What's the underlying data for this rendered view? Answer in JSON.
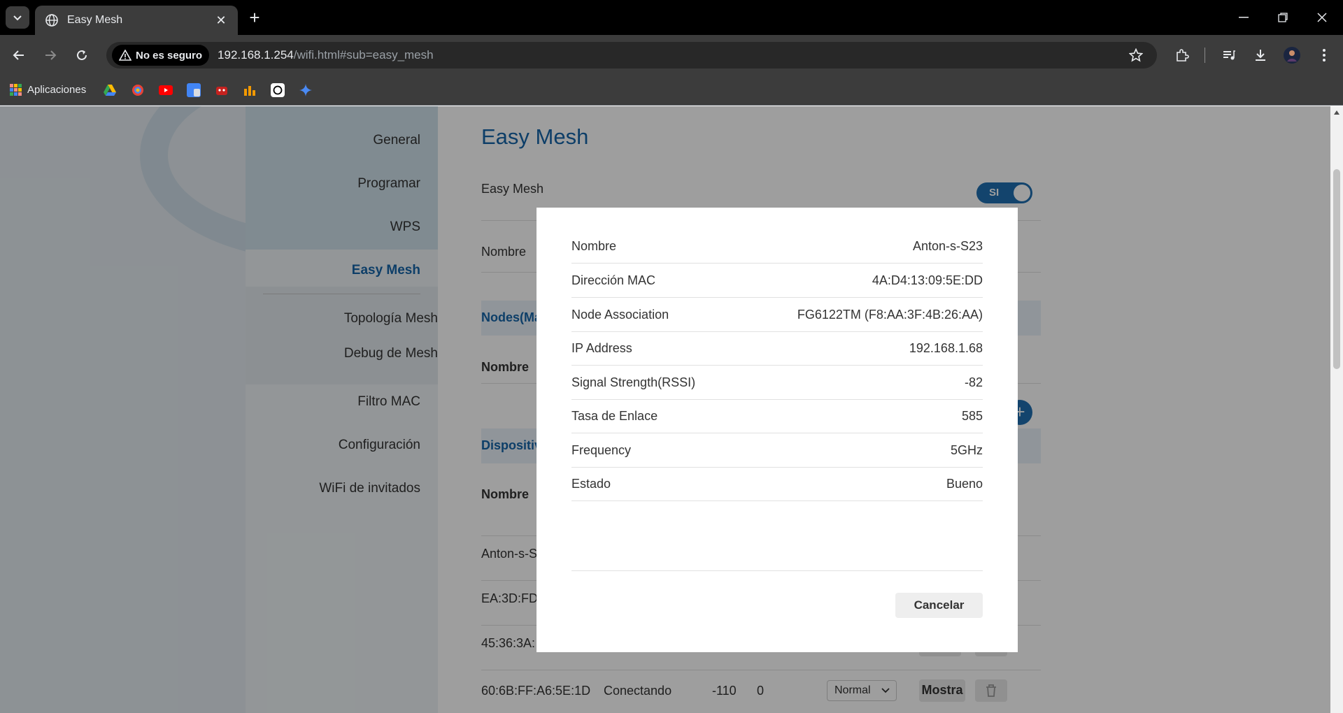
{
  "browser": {
    "tab_title": "Easy Mesh",
    "security_label": "No es seguro",
    "url_host": "192.168.1.254",
    "url_path": "/wifi.html#sub=easy_mesh",
    "bookmarks_apps_label": "Aplicaciones"
  },
  "sidebar": {
    "items": [
      {
        "label": "General"
      },
      {
        "label": "Programar"
      },
      {
        "label": "WPS"
      },
      {
        "label": "Easy Mesh"
      },
      {
        "label": "Filtro MAC"
      },
      {
        "label": "Configuración"
      },
      {
        "label": "WiFi de invitados"
      }
    ],
    "subitems": [
      {
        "label": "Topología Mesh"
      },
      {
        "label": "Debug de Mesh"
      }
    ]
  },
  "main": {
    "title": "Easy Mesh",
    "easy_mesh_label": "Easy Mesh",
    "toggle_label": "SI",
    "nombre_label": "Nombre",
    "nodes_header": "Nodes(Ma",
    "nodes_col_nombre": "Nombre",
    "devices_header": "Dispositiv",
    "devices_col_nombre": "Nombre",
    "devices": [
      {
        "name": "Anton-s-S"
      },
      {
        "name": "EA:3D:FD"
      },
      {
        "name": "45:36:3A:"
      },
      {
        "name": "60:6B:FF:A6:5E:1D",
        "status": "Conectando",
        "rssi": "-110",
        "rate": "0",
        "mode": "Normal",
        "action": "Mostra"
      }
    ]
  },
  "modal": {
    "rows": [
      {
        "label": "Nombre",
        "value": "Anton-s-S23"
      },
      {
        "label": "Dirección MAC",
        "value": "4A:D4:13:09:5E:DD"
      },
      {
        "label": "Node Association",
        "value": "FG6122TM (F8:AA:3F:4B:26:AA)"
      },
      {
        "label": "IP Address",
        "value": "192.168.1.68"
      },
      {
        "label": "Signal Strength(RSSI)",
        "value": "-82"
      },
      {
        "label": "Tasa de Enlace",
        "value": "585"
      },
      {
        "label": "Frequency",
        "value": "5GHz"
      },
      {
        "label": "Estado",
        "value": "Bueno"
      }
    ],
    "cancel_label": "Cancelar"
  },
  "colors": {
    "accent": "#1565a8",
    "chrome_dark": "#3c3c3c",
    "overlay": "rgba(0,0,0,0.38)"
  }
}
